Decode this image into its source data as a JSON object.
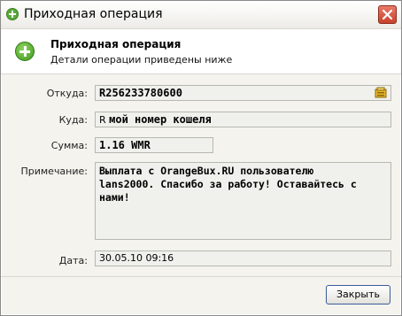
{
  "window": {
    "title": "Приходная операция"
  },
  "header": {
    "title": "Приходная операция",
    "subtitle": "Детали операции приведены ниже"
  },
  "form": {
    "from_label": "Откуда:",
    "from_value": "R256233780600",
    "to_label": "Куда:",
    "to_prefix": "R",
    "to_value": "мой номер кошеля",
    "amount_label": "Сумма:",
    "amount_value": "1.16 WMR",
    "note_label": "Примечание:",
    "note_value": "Выплата с OrangeBux.RU пользователю\nlans2000. Спасибо за работу! Оставайтесь с нами!",
    "date_label": "Дата:",
    "date_value": "30.05.10 09:16"
  },
  "buttons": {
    "close_label": "Закрыть"
  },
  "colors": {
    "accent": "#5aa83a",
    "close_button": "#c8412c"
  }
}
